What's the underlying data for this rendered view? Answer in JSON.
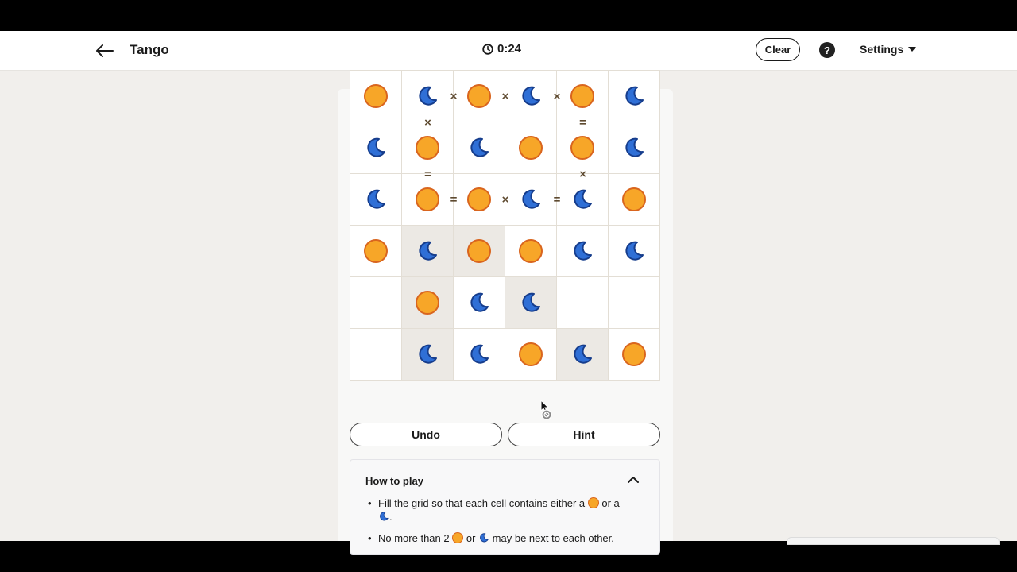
{
  "header": {
    "title": "Tango",
    "timer": "0:24",
    "clear_label": "Clear",
    "help_label": "?",
    "settings_label": "Settings"
  },
  "board": {
    "rows": [
      [
        "sun",
        "moon",
        "sun",
        "moon",
        "sun",
        "moon"
      ],
      [
        "moon",
        "sun",
        "moon",
        "sun",
        "sun",
        "moon"
      ],
      [
        "moon",
        "sun",
        "sun",
        "moon",
        "moon",
        "sun"
      ],
      [
        "sun",
        "moon",
        "sun",
        "sun",
        "moon",
        "moon"
      ],
      [
        "",
        "sun",
        "moon",
        "moon",
        "",
        ""
      ],
      [
        "",
        "moon",
        "moon",
        "sun",
        "moon",
        "sun"
      ]
    ],
    "locked": [
      [
        false,
        false,
        false,
        false,
        false,
        false
      ],
      [
        false,
        false,
        false,
        false,
        false,
        false
      ],
      [
        false,
        false,
        false,
        false,
        false,
        false
      ],
      [
        false,
        true,
        true,
        false,
        false,
        false
      ],
      [
        false,
        true,
        false,
        true,
        false,
        false
      ],
      [
        false,
        true,
        false,
        false,
        true,
        false
      ]
    ],
    "h_constraints": [
      {
        "row": 0,
        "after_col": 1,
        "symbol": "×"
      },
      {
        "row": 0,
        "after_col": 2,
        "symbol": "×"
      },
      {
        "row": 0,
        "after_col": 3,
        "symbol": "×"
      },
      {
        "row": 2,
        "after_col": 1,
        "symbol": "="
      },
      {
        "row": 2,
        "after_col": 2,
        "symbol": "×"
      },
      {
        "row": 2,
        "after_col": 3,
        "symbol": "="
      }
    ],
    "v_constraints": [
      {
        "after_row": 0,
        "col": 1,
        "symbol": "×"
      },
      {
        "after_row": 0,
        "col": 4,
        "symbol": "="
      },
      {
        "after_row": 1,
        "col": 1,
        "symbol": "="
      },
      {
        "after_row": 1,
        "col": 4,
        "symbol": "×"
      }
    ]
  },
  "actions": {
    "undo_label": "Undo",
    "hint_label": "Hint"
  },
  "how_to_play": {
    "title": "How to play",
    "rule1_part1": "Fill the grid so that each cell contains either a",
    "rule1_part2": "or a",
    "rule1_part3": ".",
    "rule2_part1": "No more than 2",
    "rule2_part2": "or",
    "rule2_part3": "may be next to each other."
  },
  "colors": {
    "sun_fill": "#f7a628",
    "sun_border": "#d9651e",
    "moon_fill": "#2f6fd6",
    "moon_border": "#163d8c",
    "locked_cell": "#ece9e4"
  }
}
